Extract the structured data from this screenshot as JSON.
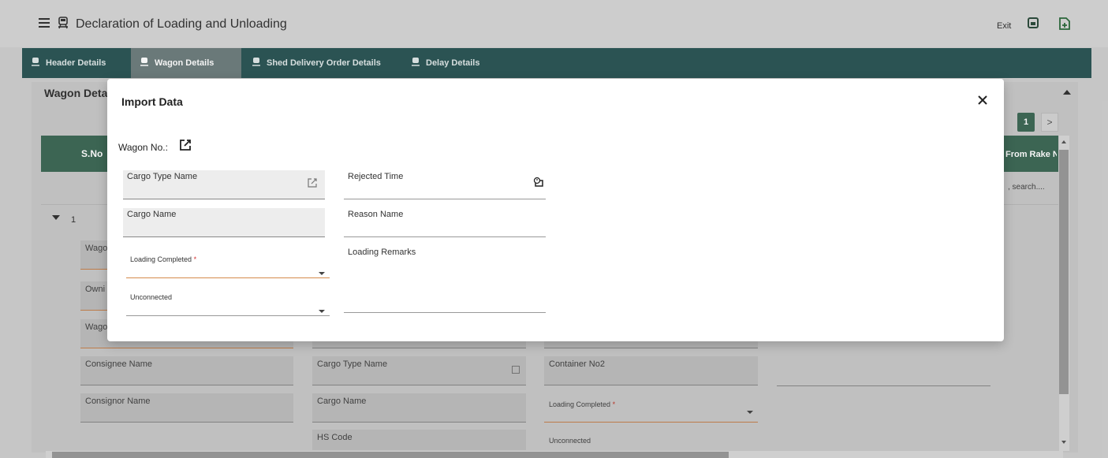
{
  "app": {
    "title": "Declaration of Loading and Unloading",
    "exit_label": "Exit",
    "save_icon": "save-icon",
    "new_icon": "add-document-icon"
  },
  "tabs": [
    {
      "label": "Header Details",
      "active": false
    },
    {
      "label": "Wagon Details",
      "active": true
    },
    {
      "label": "Shed Delivery Order Details",
      "active": false
    },
    {
      "label": "Delay Details",
      "active": false
    }
  ],
  "section": {
    "title": "Wagon Details",
    "page_number": "1",
    "next_label": ">",
    "table": {
      "col_sno": "S.No",
      "col_right": "From Rake No",
      "search_placeholder": ", search....",
      "row_number": "1"
    },
    "fields": {
      "wagon": "Wago",
      "owning": "Owni",
      "wagon2": "Wago",
      "consignee_name": "Consignee Name",
      "consignor_name": "Consignor Name",
      "cargo_type_name": "Cargo Type Name",
      "cargo_name": "Cargo Name",
      "hs_code": "HS Code",
      "container_no2": "Container No2",
      "loading_completed": "Loading Completed",
      "unconnected": "Unconnected"
    }
  },
  "modal": {
    "title": "Import Data",
    "close_label": "×",
    "wagon_no_label": "Wagon No.:",
    "fields": {
      "cargo_type_name": "Cargo Type Name",
      "rejected_time": "Rejected Time",
      "cargo_name": "Cargo Name",
      "reason_name": "Reason Name",
      "loading_completed": "Loading Completed",
      "loading_remarks": "Loading Remarks",
      "unconnected": "Unconnected"
    },
    "required_marker": "*"
  },
  "colors": {
    "tabbar": "#2d5757",
    "active_tab": "#6f7e7e",
    "table_header": "#3f6a57",
    "focus_orange": "#d58a4c",
    "required_red": "#d23030"
  }
}
